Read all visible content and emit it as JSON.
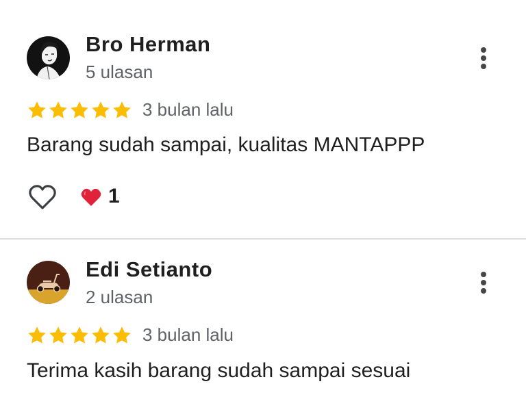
{
  "reviews": [
    {
      "author": "Bro Herman",
      "review_count": "5 ulasan",
      "rating": 5,
      "date": "3 bulan lalu",
      "text": "Barang sudah sampai, kualitas MANTAPPP",
      "reaction_count": "1",
      "avatar_icon": "person-sketch-avatar",
      "menu_icon": "more-vert-icon"
    },
    {
      "author": "Edi Setianto",
      "review_count": "2 ulasan",
      "rating": 5,
      "date": "3 bulan lalu",
      "text": "Terima kasih barang sudah sampai sesuai",
      "avatar_icon": "scooter-avatar",
      "menu_icon": "more-vert-icon"
    }
  ],
  "colors": {
    "star": "#fbbc04",
    "reaction_heart": "#e0223a",
    "secondary_text": "#5f6368",
    "divider": "#dcdcdc"
  }
}
